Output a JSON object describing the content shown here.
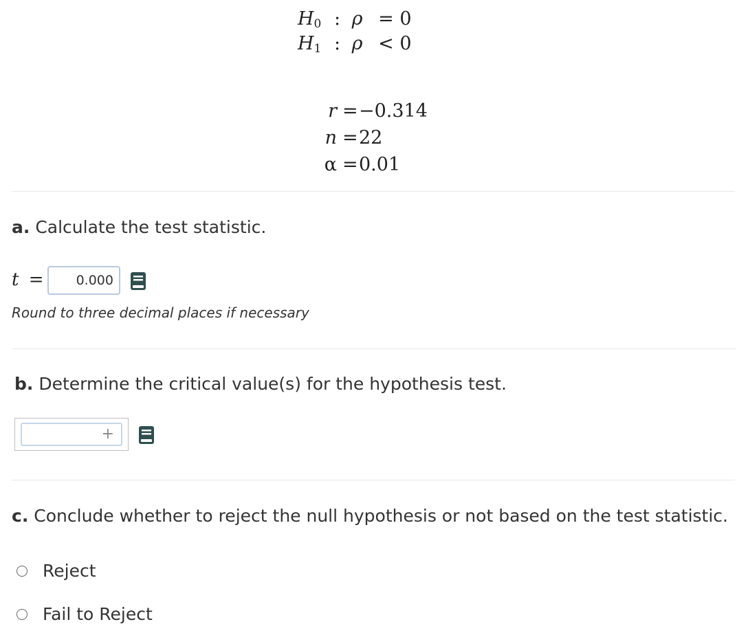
{
  "hypotheses": {
    "h0": {
      "symbol": "H",
      "sub": "0",
      "colon": ":",
      "param": "ρ",
      "relation": "= 0"
    },
    "h1": {
      "symbol": "H",
      "sub": "1",
      "colon": ":",
      "param": "ρ",
      "relation": "< 0"
    }
  },
  "given": {
    "r": {
      "var": "r",
      "eq": "=",
      "val": "−0.314"
    },
    "n": {
      "var": "n",
      "eq": "=",
      "val": "22"
    },
    "alpha": {
      "var": "α",
      "eq": "=",
      "val": "0.01"
    }
  },
  "part_a": {
    "letter": "a.",
    "text": "Calculate the test statistic.",
    "t_var": "t",
    "t_eq": "=",
    "answer_value": "0.000",
    "hint": "Round to three decimal places if necessary"
  },
  "part_b": {
    "letter": "b.",
    "text": "Determine the critical value(s) for the hypothesis test.",
    "add_symbol": "+"
  },
  "part_c": {
    "letter": "c.",
    "text": "Conclude whether to reject the null hypothesis or not based on the test statistic.",
    "options": [
      "Reject",
      "Fail to Reject"
    ]
  },
  "colors": {
    "icon": "#2f4f4f",
    "input_border": "#b8c9dd",
    "divider": "#e8e8e8"
  },
  "icons": [
    "book-icon"
  ]
}
